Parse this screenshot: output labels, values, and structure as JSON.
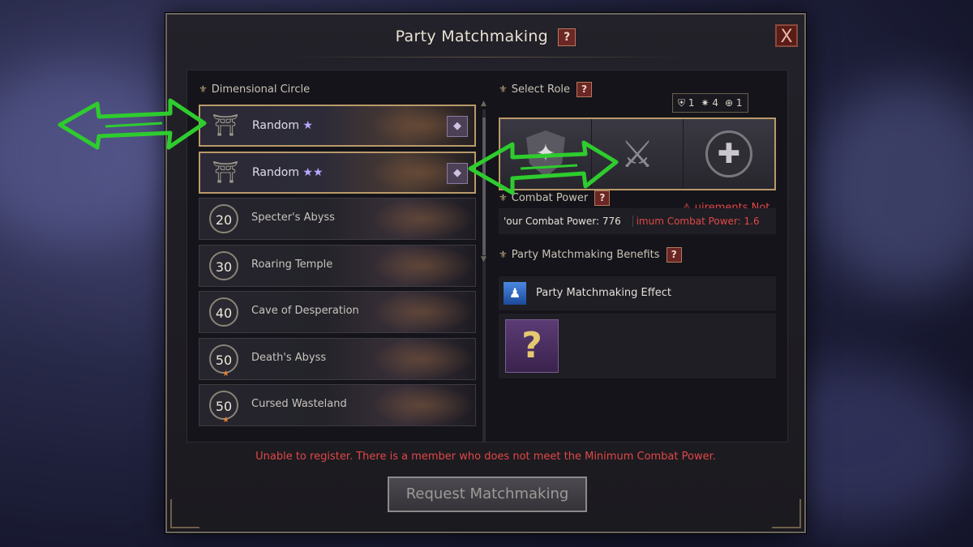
{
  "dialog": {
    "title": "Party Matchmaking",
    "help_label": "?",
    "close_label": "X"
  },
  "left": {
    "header": "Dimensional Circle"
  },
  "dungeons": [
    {
      "level": "",
      "name": "Random",
      "stars": "★",
      "selected": true,
      "locked": true
    },
    {
      "level": "",
      "name": "Random",
      "stars": "★★",
      "selected": true,
      "locked": true
    },
    {
      "level": "20",
      "name": "Specter's Abyss",
      "stars": "",
      "selected": false
    },
    {
      "level": "30",
      "name": "Roaring Temple",
      "stars": "",
      "selected": false
    },
    {
      "level": "40",
      "name": "Cave of Desperation",
      "stars": "",
      "selected": false
    },
    {
      "level": "50",
      "name": "Death's Abyss",
      "stars": "",
      "selected": false,
      "star_mark": true
    },
    {
      "level": "50",
      "name": "Cursed Wasteland",
      "stars": "",
      "selected": false,
      "star_mark": true
    }
  ],
  "roles": {
    "header": "Select Role",
    "counts": {
      "tank": "1",
      "damage": "4",
      "healer": "1"
    },
    "items": [
      {
        "name": "tank",
        "icon": "shield-icon"
      },
      {
        "name": "damage",
        "icon": "crossed-swords-icon"
      },
      {
        "name": "healer",
        "icon": "cross-icon"
      }
    ]
  },
  "combat_power": {
    "header": "Combat Power",
    "warning": "uirements Not",
    "your_cp": "'our Combat Power: 776",
    "min_cp": "imum Combat Power: 1.6"
  },
  "benefits": {
    "header": "Party Matchmaking Benefits",
    "effect_label": "Party Matchmaking Effect",
    "mystery_label": "?"
  },
  "footer": {
    "error": "Unable to register. There is a member who does not meet the Minimum Combat Power.",
    "request_button": "Request Matchmaking"
  },
  "colors": {
    "accent_gold": "#b99a6a",
    "error_red": "#e04848",
    "annotation_green": "#2ecc2e"
  }
}
